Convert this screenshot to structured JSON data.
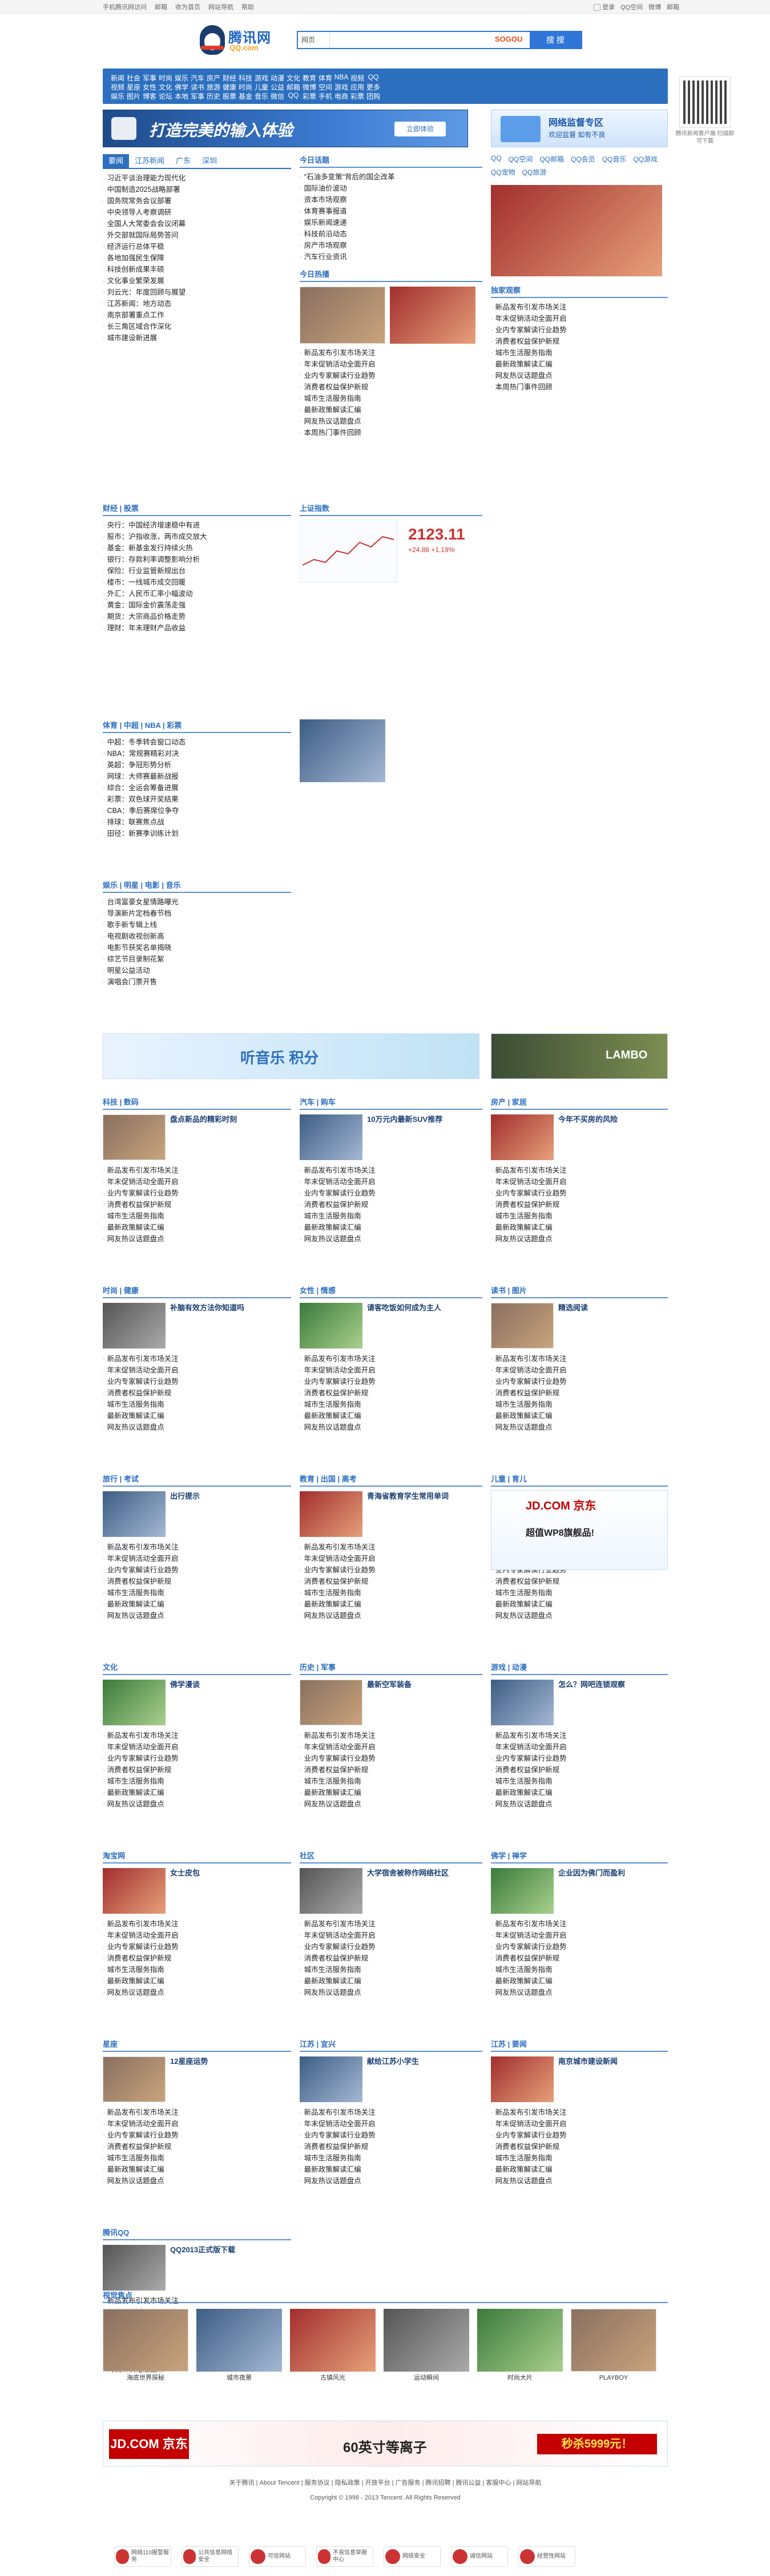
{
  "topbar": {
    "links": [
      "手机腾讯网访问",
      "邮箱",
      "收为首页",
      "网站导航",
      "帮助"
    ],
    "right": [
      "登录",
      "QQ空间",
      "微博",
      "邮箱"
    ]
  },
  "logo": {
    "name": "腾讯网",
    "url": "QQ.com"
  },
  "search": {
    "category": "网页",
    "placeholder": "",
    "sogou": "SOGOU",
    "button": "搜 搜"
  },
  "qr": {
    "text": "腾讯新闻客户端 扫描即可下载"
  },
  "nav": {
    "row1": [
      "新闻",
      "社会",
      "军事",
      "时尚",
      "娱乐",
      "汽车",
      "房产",
      "财经",
      "科技",
      "游戏",
      "动漫",
      "文化",
      "教育",
      "体育",
      "NBA",
      "视频",
      "QQ"
    ],
    "row2": [
      "视频",
      "星座",
      "女性",
      "文化",
      "佛学",
      "读书",
      "旅游",
      "健康",
      "时尚",
      "儿童",
      "公益",
      "邮箱",
      "微博",
      "空间",
      "游戏",
      "应用",
      "更多"
    ],
    "row3": [
      "娱乐",
      "图片",
      "博客",
      "论坛",
      "本地",
      "军事",
      "历史",
      "股票",
      "基金",
      "音乐",
      "微信",
      "QQ",
      "彩票",
      "手机",
      "电商",
      "彩票",
      "团购"
    ]
  },
  "banner": {
    "title": "打造完美的输入体验",
    "sub": "完美 | 的 | 2012",
    "button": "立即体验"
  },
  "rbanner": {
    "title": "网络监督专区",
    "sub": "欢迎监督 如有不良"
  },
  "tabs_news": [
    "要闻",
    "江苏新闻",
    "广东",
    "深圳"
  ],
  "news_top": [
    "习近平谈治理能力现代化",
    "中国制造2025战略部署",
    "国务院常务会议部署",
    "中央领导人考察调研",
    "全国人大常委会会议闭幕",
    "外交部就国际局势答问",
    "经济运行总体平稳",
    "各地加强民生保障",
    "科技创新成果丰硕",
    "文化事业繁荣发展",
    "刘云光：年度回顾与展望",
    "江苏新闻：地方动态",
    "南京部署重点工作",
    "长三角区域合作深化",
    "城市建设新进展"
  ],
  "center_head": "今日话题",
  "center_news": [
    "\"石油多变策\"背后的国企改革",
    "国际油价波动",
    "资本市场观察",
    "体育赛事报道",
    "娱乐新闻速递",
    "科技前沿动态",
    "房产市场观察",
    "汽车行业资讯"
  ],
  "center_video_head": "今日热播",
  "right_services": [
    "QQ",
    "QQ空间",
    "QQ邮箱",
    "QQ会员",
    "QQ音乐",
    "QQ游戏",
    "QQ宠物",
    "QQ旅游"
  ],
  "section_finance": {
    "title": "财经 | 股票",
    "index_label": "上证指数",
    "index_value": "2123.11",
    "index_change": "+24.86  +1.19%"
  },
  "finance_news": [
    "央行：中国经济增速稳中有进",
    "股市：沪指收涨，两市成交放大",
    "基金：新基金发行持续火热",
    "银行：存款利率调整影响分析",
    "保险：行业监管新规出台",
    "楼市：一线城市成交回暖",
    "外汇：人民币汇率小幅波动",
    "黄金：国际金价震荡走强",
    "期货：大宗商品价格走势",
    "理财：年末理财产品收益"
  ],
  "sports_head": "体育 | 中超 | NBA | 彩票",
  "sports_news": [
    "中超：冬季转会窗口动态",
    "NBA：常规赛精彩对决",
    "英超：争冠形势分析",
    "网球：大师赛最新战报",
    "综合：全运会筹备进展",
    "彩票：双色球开奖结果",
    "CBA：季后赛席位争夺",
    "排球：联赛焦点战",
    "田径：新赛季训练计划"
  ],
  "ent_head": "娱乐 | 明星 | 电影 | 音乐",
  "ent_news": [
    "台湾富豪女星情路曝光",
    "导演新片定档春节档",
    "歌手新专辑上线",
    "电视剧收视创新高",
    "电影节获奖名单揭晓",
    "综艺节目录制花絮",
    "明星公益活动",
    "演唱会门票开售"
  ],
  "blog_head": "独家观察",
  "ads": {
    "music": "听音乐 积分",
    "car": "LAMBO",
    "jd": "JD.COM 京东",
    "jd_sub": "超值WP8旗舰品!",
    "jd_bottom": "60英寸等离子",
    "jd_price": "秒杀5999元！"
  },
  "sections": [
    {
      "title": "科技 | 数码",
      "head": "盘点新品的精彩时刻"
    },
    {
      "title": "汽车 | 购车",
      "head": "10万元内最新SUV推荐"
    },
    {
      "title": "房产 | 家居",
      "head": "今年不买房的风险"
    },
    {
      "title": "时尚 | 健康",
      "head": "补脑有效方法你知道吗"
    },
    {
      "title": "女性 | 情感",
      "head": "请客吃饭如何成为主人"
    },
    {
      "title": "读书 | 图片",
      "head": "精选阅读"
    },
    {
      "title": "旅行 | 考试",
      "head": "出行提示"
    },
    {
      "title": "教育 | 出国 | 高考",
      "head": "青海省教育学生常用单词"
    },
    {
      "title": "儿童 | 育儿",
      "head": "幼儿园家长课堂"
    },
    {
      "title": "文化",
      "head": "佛学漫谈"
    },
    {
      "title": "历史 | 军事",
      "head": "最新空军装备"
    },
    {
      "title": "游戏 | 动漫",
      "head": "怎么？网吧连锁观察"
    },
    {
      "title": "淘宝网",
      "head": "女士皮包"
    },
    {
      "title": "社区",
      "head": "大学宿舍被称作网络社区"
    },
    {
      "title": "佛学 | 禅学",
      "head": "企业因为佛门而盈利"
    },
    {
      "title": "星座",
      "head": "12星座运势"
    },
    {
      "title": "江苏 | 宜兴",
      "head": "献给江苏小学生"
    },
    {
      "title": "江苏 | 要闻",
      "head": "南京城市建设新闻"
    },
    {
      "title": "腾讯QQ",
      "head": "QQ2013正式版下载"
    }
  ],
  "filler_list": [
    "新品发布引发市场关注",
    "年末促销活动全面开启",
    "业内专家解读行业趋势",
    "消费者权益保护新规",
    "城市生活服务指南",
    "最新政策解读汇编",
    "网友热议话题盘点",
    "本周热门事件回顾"
  ],
  "photos": {
    "title": "视觉焦点",
    "captions": [
      "海底世界探秘",
      "城市夜景",
      "古镇风光",
      "运动瞬间",
      "时尚大片",
      "PLAYBOY"
    ]
  },
  "footer": {
    "line1": "关于腾讯 | About Tencent | 服务协议 | 隐私政策 | 开放平台 | 广告服务 | 腾讯招聘 | 腾讯公益 | 客服中心 | 网站导航",
    "line2": "Copyright © 1998 - 2013 Tencent. All Rights Reserved"
  },
  "badges": [
    "网络110报警服务",
    "公共信息网络安全",
    "可信网站",
    "不良信息举报中心",
    "网络安全",
    "诚信网站",
    "经营性网站"
  ]
}
